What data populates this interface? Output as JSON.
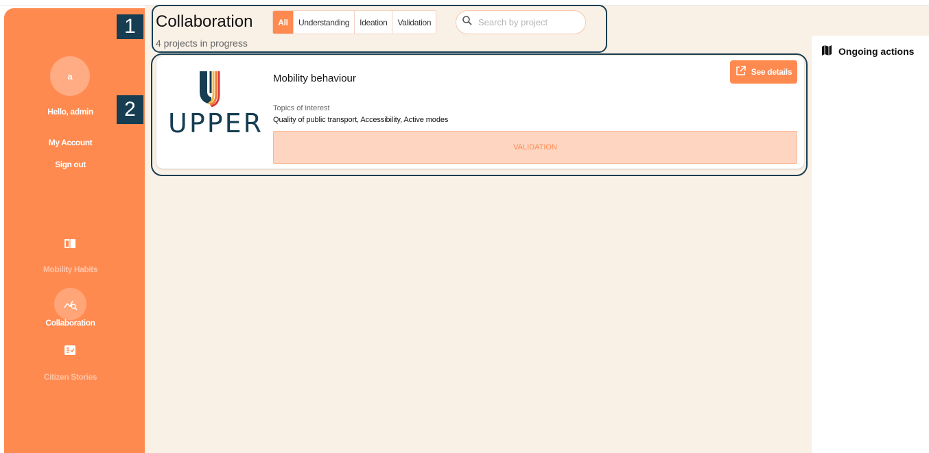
{
  "sidebar": {
    "avatar_initial": "a",
    "greeting": "Hello, admin",
    "my_account": "My Account",
    "sign_out": "Sign out",
    "nav": [
      {
        "label": "Mobility Habits",
        "icon": "book-icon",
        "active": false
      },
      {
        "label": "Collaboration",
        "icon": "collaboration-icon",
        "active": true
      },
      {
        "label": "Citizen Stories",
        "icon": "stories-icon",
        "active": false
      }
    ]
  },
  "header": {
    "title": "Collaboration",
    "subtitle": "4 projects in progress",
    "filters": [
      "All",
      "Understanding",
      "Ideation",
      "Validation"
    ],
    "active_filter": "All",
    "search_placeholder": "Search by project"
  },
  "project": {
    "logo_text": "UPPER",
    "title": "Mobility behaviour",
    "topics_label": "Topics of interest",
    "topics": "Quality of public transport, Accessibility, Active modes",
    "details_button": "See details",
    "stage": "VALIDATION"
  },
  "right_panel": {
    "title": "Ongoing actions",
    "icon": "map-icon"
  },
  "callouts": [
    "1",
    "2"
  ],
  "colors": {
    "accent": "#ff8a50",
    "background": "#f9f0e6",
    "callout": "#163d52"
  }
}
